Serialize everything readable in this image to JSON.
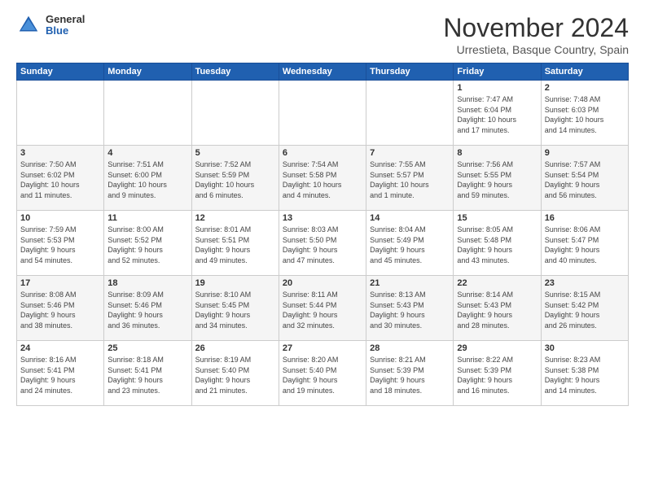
{
  "logo": {
    "general": "General",
    "blue": "Blue"
  },
  "title": "November 2024",
  "location": "Urrestieta, Basque Country, Spain",
  "days_of_week": [
    "Sunday",
    "Monday",
    "Tuesday",
    "Wednesday",
    "Thursday",
    "Friday",
    "Saturday"
  ],
  "weeks": [
    [
      {
        "day": "",
        "info": ""
      },
      {
        "day": "",
        "info": ""
      },
      {
        "day": "",
        "info": ""
      },
      {
        "day": "",
        "info": ""
      },
      {
        "day": "",
        "info": ""
      },
      {
        "day": "1",
        "info": "Sunrise: 7:47 AM\nSunset: 6:04 PM\nDaylight: 10 hours\nand 17 minutes."
      },
      {
        "day": "2",
        "info": "Sunrise: 7:48 AM\nSunset: 6:03 PM\nDaylight: 10 hours\nand 14 minutes."
      }
    ],
    [
      {
        "day": "3",
        "info": "Sunrise: 7:50 AM\nSunset: 6:02 PM\nDaylight: 10 hours\nand 11 minutes."
      },
      {
        "day": "4",
        "info": "Sunrise: 7:51 AM\nSunset: 6:00 PM\nDaylight: 10 hours\nand 9 minutes."
      },
      {
        "day": "5",
        "info": "Sunrise: 7:52 AM\nSunset: 5:59 PM\nDaylight: 10 hours\nand 6 minutes."
      },
      {
        "day": "6",
        "info": "Sunrise: 7:54 AM\nSunset: 5:58 PM\nDaylight: 10 hours\nand 4 minutes."
      },
      {
        "day": "7",
        "info": "Sunrise: 7:55 AM\nSunset: 5:57 PM\nDaylight: 10 hours\nand 1 minute."
      },
      {
        "day": "8",
        "info": "Sunrise: 7:56 AM\nSunset: 5:55 PM\nDaylight: 9 hours\nand 59 minutes."
      },
      {
        "day": "9",
        "info": "Sunrise: 7:57 AM\nSunset: 5:54 PM\nDaylight: 9 hours\nand 56 minutes."
      }
    ],
    [
      {
        "day": "10",
        "info": "Sunrise: 7:59 AM\nSunset: 5:53 PM\nDaylight: 9 hours\nand 54 minutes."
      },
      {
        "day": "11",
        "info": "Sunrise: 8:00 AM\nSunset: 5:52 PM\nDaylight: 9 hours\nand 52 minutes."
      },
      {
        "day": "12",
        "info": "Sunrise: 8:01 AM\nSunset: 5:51 PM\nDaylight: 9 hours\nand 49 minutes."
      },
      {
        "day": "13",
        "info": "Sunrise: 8:03 AM\nSunset: 5:50 PM\nDaylight: 9 hours\nand 47 minutes."
      },
      {
        "day": "14",
        "info": "Sunrise: 8:04 AM\nSunset: 5:49 PM\nDaylight: 9 hours\nand 45 minutes."
      },
      {
        "day": "15",
        "info": "Sunrise: 8:05 AM\nSunset: 5:48 PM\nDaylight: 9 hours\nand 43 minutes."
      },
      {
        "day": "16",
        "info": "Sunrise: 8:06 AM\nSunset: 5:47 PM\nDaylight: 9 hours\nand 40 minutes."
      }
    ],
    [
      {
        "day": "17",
        "info": "Sunrise: 8:08 AM\nSunset: 5:46 PM\nDaylight: 9 hours\nand 38 minutes."
      },
      {
        "day": "18",
        "info": "Sunrise: 8:09 AM\nSunset: 5:46 PM\nDaylight: 9 hours\nand 36 minutes."
      },
      {
        "day": "19",
        "info": "Sunrise: 8:10 AM\nSunset: 5:45 PM\nDaylight: 9 hours\nand 34 minutes."
      },
      {
        "day": "20",
        "info": "Sunrise: 8:11 AM\nSunset: 5:44 PM\nDaylight: 9 hours\nand 32 minutes."
      },
      {
        "day": "21",
        "info": "Sunrise: 8:13 AM\nSunset: 5:43 PM\nDaylight: 9 hours\nand 30 minutes."
      },
      {
        "day": "22",
        "info": "Sunrise: 8:14 AM\nSunset: 5:43 PM\nDaylight: 9 hours\nand 28 minutes."
      },
      {
        "day": "23",
        "info": "Sunrise: 8:15 AM\nSunset: 5:42 PM\nDaylight: 9 hours\nand 26 minutes."
      }
    ],
    [
      {
        "day": "24",
        "info": "Sunrise: 8:16 AM\nSunset: 5:41 PM\nDaylight: 9 hours\nand 24 minutes."
      },
      {
        "day": "25",
        "info": "Sunrise: 8:18 AM\nSunset: 5:41 PM\nDaylight: 9 hours\nand 23 minutes."
      },
      {
        "day": "26",
        "info": "Sunrise: 8:19 AM\nSunset: 5:40 PM\nDaylight: 9 hours\nand 21 minutes."
      },
      {
        "day": "27",
        "info": "Sunrise: 8:20 AM\nSunset: 5:40 PM\nDaylight: 9 hours\nand 19 minutes."
      },
      {
        "day": "28",
        "info": "Sunrise: 8:21 AM\nSunset: 5:39 PM\nDaylight: 9 hours\nand 18 minutes."
      },
      {
        "day": "29",
        "info": "Sunrise: 8:22 AM\nSunset: 5:39 PM\nDaylight: 9 hours\nand 16 minutes."
      },
      {
        "day": "30",
        "info": "Sunrise: 8:23 AM\nSunset: 5:38 PM\nDaylight: 9 hours\nand 14 minutes."
      }
    ]
  ]
}
